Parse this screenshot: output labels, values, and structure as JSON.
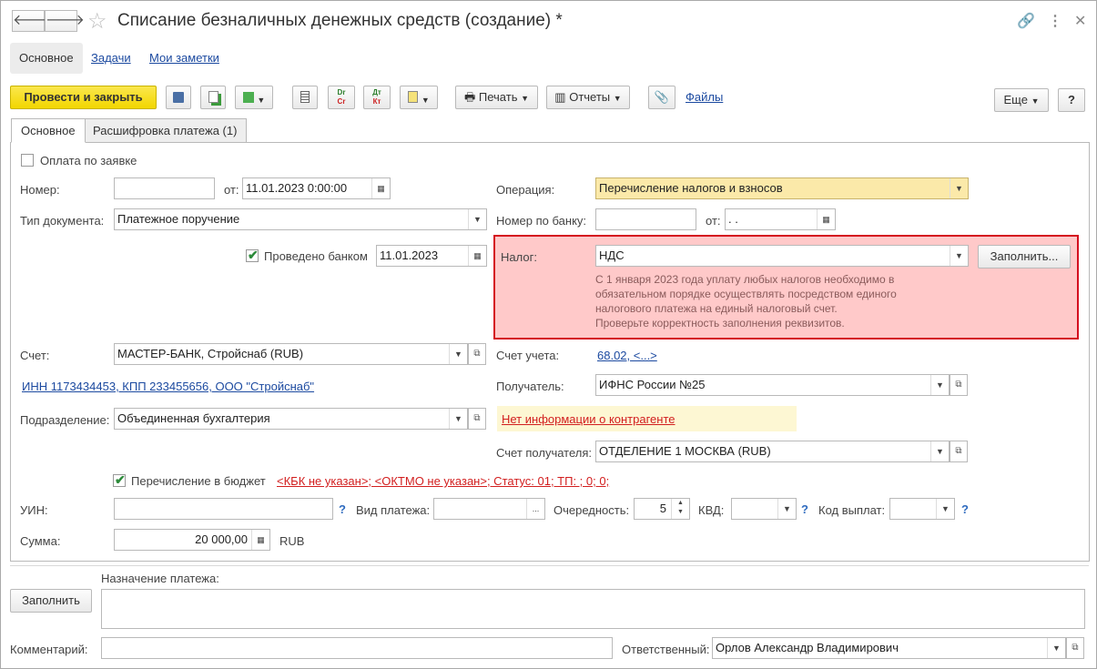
{
  "window": {
    "title": "Списание безналичных денежных средств (создание) *"
  },
  "nav": {
    "tabs": [
      "Основное",
      "Задачи",
      "Мои заметки"
    ]
  },
  "toolbar": {
    "post_close": "Провести и закрыть",
    "print": "Печать",
    "reports": "Отчеты",
    "files": "Файлы",
    "more": "Еще",
    "help": "?",
    "dr_icon_top": "Dr",
    "dr_icon_bottom": "Cr",
    "dtkt_top": "Дт",
    "dtkt_bottom": "Кт"
  },
  "tabs": {
    "main": "Основное",
    "breakdown": "Расшифровка платежа (1)"
  },
  "form": {
    "pay_by_request": "Оплата по заявке",
    "number_label": "Номер:",
    "number_value": "",
    "from_label": "от:",
    "date_value": "11.01.2023  0:00:00",
    "doc_type_label": "Тип документа:",
    "doc_type_value": "Платежное поручение",
    "bank_done_label": "Проведено банком",
    "bank_date": "11.01.2023",
    "operation_label": "Операция:",
    "operation_value": "Перечисление налогов и взносов",
    "bank_number_label": "Номер по банку:",
    "bank_number_value": "",
    "bank_from_label": "от:",
    "bank_from_value": " .  .",
    "tax_label": "Налог:",
    "tax_value": "НДС",
    "fill_label": "Заполнить...",
    "tax_note_1": "С 1 января 2023 года уплату любых налогов необходимо в",
    "tax_note_2": "обязательном порядке осуществлять посредством единого",
    "tax_note_3": "налогового платежа на единый налоговый счет.",
    "tax_note_4": "Проверьте корректность заполнения реквизитов.",
    "account_label": "Счет:",
    "account_value": "МАСТЕР-БАНК, Стройснаб (RUB)",
    "inn_link": "ИНН 1173434453, КПП 233455656, ООО \"Стройснаб\"",
    "ledger_label": "Счет учета:",
    "ledger_value": "68.02, <...>",
    "recipient_label": "Получатель:",
    "recipient_value": "ИФНС России №25",
    "no_info": "Нет информации о контрагенте",
    "division_label": "Подразделение:",
    "division_value": "Объединенная бухгалтерия",
    "recipient_account_label": "Счет получателя:",
    "recipient_account_value": "ОТДЕЛЕНИЕ 1 МОСКВА (RUB)",
    "budget_label": "Перечисление в бюджет",
    "budget_status": "<КБК не указан>; <ОКТМО не указан>; Статус: 01; ТП: ; 0; 0;",
    "uin_label": "УИН:",
    "uin_value": "",
    "pay_type_label": "Вид платежа:",
    "pay_type_value": "",
    "priority_label": "Очередность:",
    "priority_value": "5",
    "kvd_label": "КВД:",
    "kvd_value": "",
    "payout_label": "Код выплат:",
    "payout_value": "",
    "sum_label": "Сумма:",
    "sum_value": "20 000,00",
    "currency": "RUB",
    "q_mark": "?"
  },
  "footer": {
    "fill_button": "Заполнить",
    "purpose_label": "Назначение платежа:",
    "purpose_value": "",
    "comment_label": "Комментарий:",
    "comment_value": "",
    "responsible_label": "Ответственный:",
    "responsible_value": "Орлов Александр Владимирович"
  },
  "colors": {
    "primary_button": "#f2d600",
    "warning_bg": "#ffc9c9",
    "warning_border": "#d40f1f",
    "link": "#1c4aa0",
    "error_link": "#d21f1f",
    "operation_bg": "#fbe9a9"
  }
}
